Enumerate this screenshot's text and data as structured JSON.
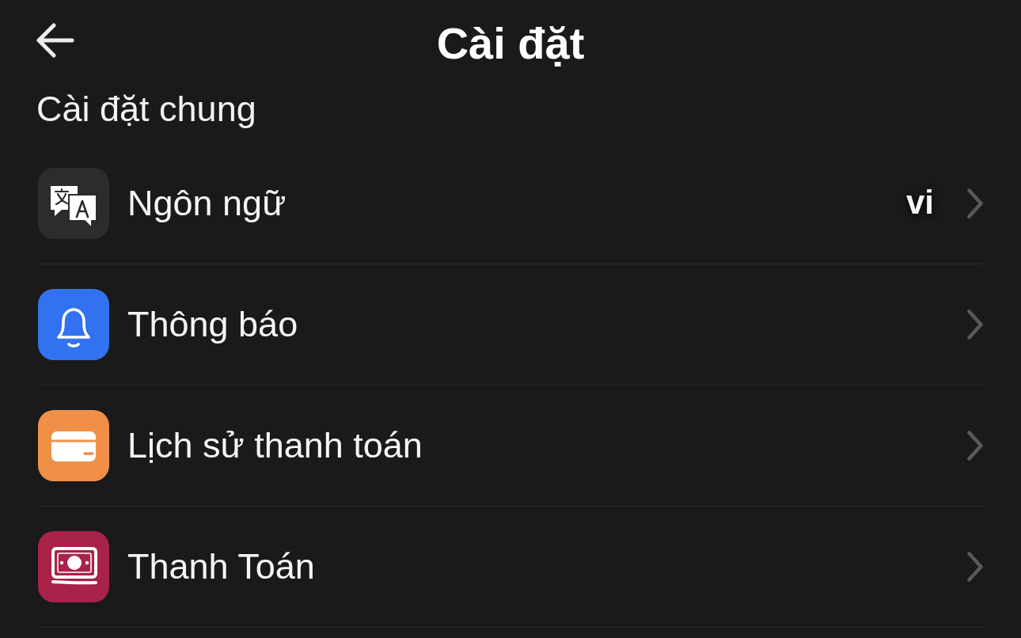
{
  "header": {
    "title": "Cài đặt"
  },
  "section": {
    "title": "Cài đặt chung"
  },
  "items": [
    {
      "label": "Ngôn ngữ",
      "value": "vi",
      "color": "#2c2c2e"
    },
    {
      "label": "Thông báo",
      "color": "#3272f0"
    },
    {
      "label": "Lịch sử thanh toán",
      "color": "#f09048"
    },
    {
      "label": "Thanh Toán",
      "color": "#a8224a"
    }
  ]
}
